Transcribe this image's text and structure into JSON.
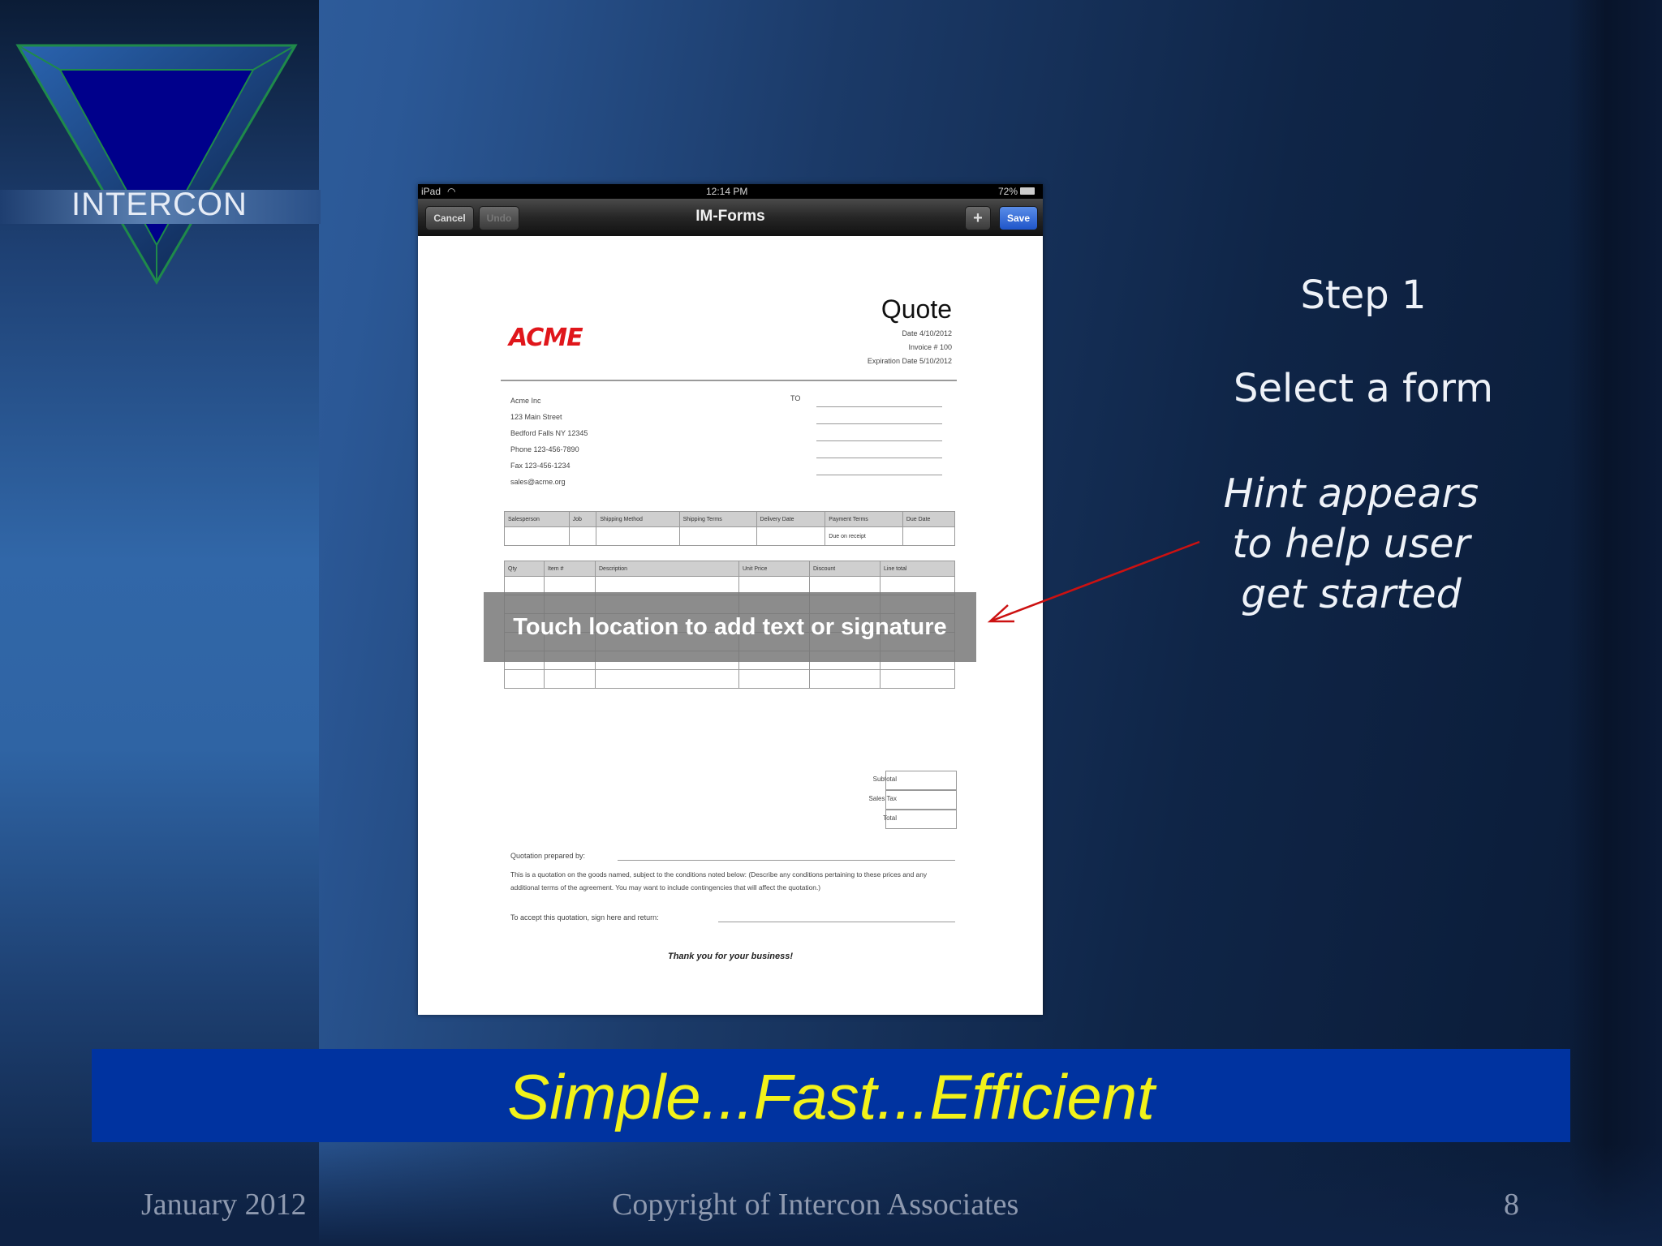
{
  "logo": {
    "name": "INTERCON"
  },
  "ipad": {
    "status": {
      "device": "iPad",
      "time": "12:14 PM",
      "battery": "72%"
    },
    "nav": {
      "cancel": "Cancel",
      "undo": "Undo",
      "title": "IM-Forms",
      "add": "+",
      "save": "Save"
    },
    "form": {
      "company": "ACME",
      "title": "Quote",
      "date": "Date 4/10/2012",
      "invoice": "Invoice # 100",
      "expiration": "Expiration Date 5/10/2012",
      "address": [
        "Acme Inc",
        "123 Main Street",
        "Bedford Falls NY 12345",
        "Phone 123-456-7890",
        "Fax 123-456-1234",
        "sales@acme.org"
      ],
      "to_label": "TO",
      "table1_headers": [
        "Salesperson",
        "Job",
        "Shipping Method",
        "Shipping Terms",
        "Delivery Date",
        "Payment Terms",
        "Due Date"
      ],
      "table1_payment": "Due on receipt",
      "table2_headers": [
        "Qty",
        "Item #",
        "Description",
        "Unit Price",
        "Discount",
        "Line total"
      ],
      "subtotal": "Subtotal",
      "sales_tax": "Sales Tax",
      "total": "Total",
      "prepared_by": "Quotation prepared by:",
      "terms": "This is a quotation on the goods named, subject to the conditions noted below: (Describe any conditions pertaining to these prices and any additional terms of the agreement. You may want to include contingencies that will affect the quotation.)",
      "accept": "To accept this quotation, sign here and return:",
      "thanks": "Thank you for your business!"
    },
    "hint": "Touch location to add text or signature"
  },
  "side": {
    "step": "Step 1",
    "action": "Select a form",
    "hint_lines": [
      "Hint appears",
      "to help user",
      "get started"
    ]
  },
  "banner": {
    "tagline": "Simple...Fast...Efficient"
  },
  "footer": {
    "date": "January 2012",
    "copyright": "Copyright of Intercon Associates",
    "page": "8"
  },
  "colors": {
    "banner": "#0033a0",
    "tagline": "#f2f21a",
    "arrow": "#cc1111",
    "acme": "#e0161b"
  },
  "icons": [
    "wifi-icon",
    "battery-icon",
    "arrow-icon",
    "logo-triangle-icon"
  ]
}
